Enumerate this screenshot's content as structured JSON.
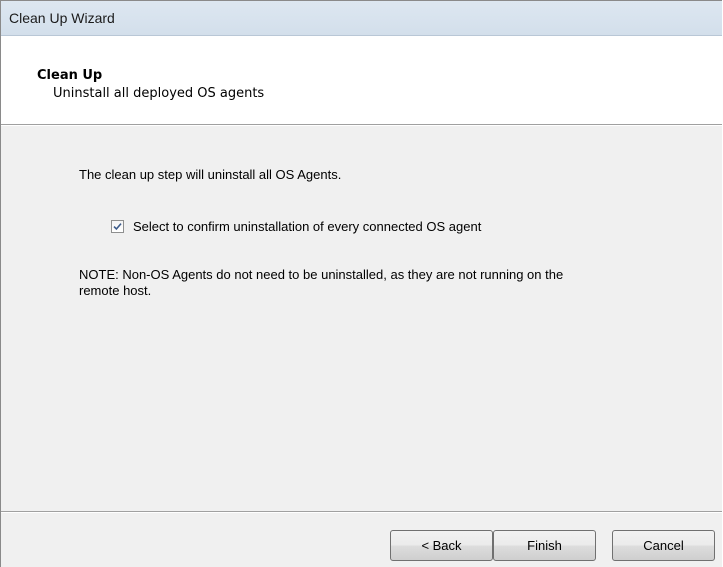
{
  "window": {
    "title": "Clean Up Wizard"
  },
  "header": {
    "title": "Clean Up",
    "subtitle": "Uninstall all deployed OS agents"
  },
  "main": {
    "intro": "The clean up step will uninstall all OS Agents.",
    "confirm": {
      "label": "Select to confirm uninstallation of every connected OS agent",
      "checked": true
    },
    "note_line1": "NOTE: Non-OS Agents do not need to be uninstalled, as they are not running on the",
    "note_line2": "remote host."
  },
  "footer": {
    "back_label": "< Back",
    "finish_label": "Finish",
    "cancel_label": "Cancel"
  }
}
